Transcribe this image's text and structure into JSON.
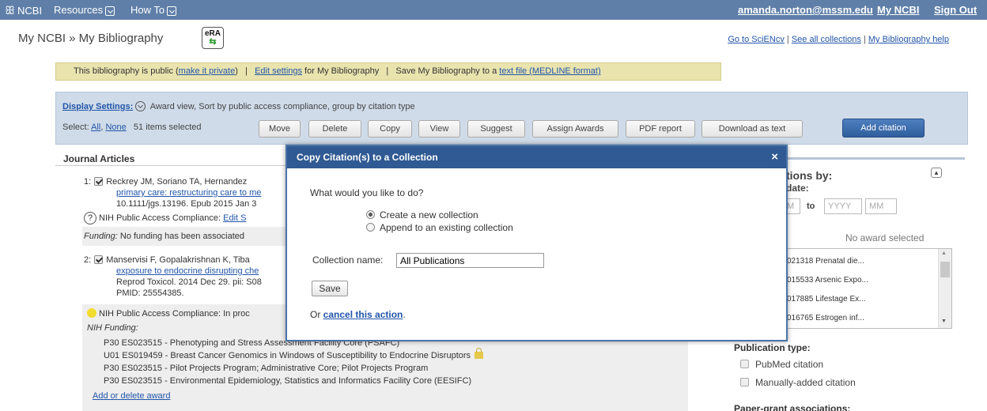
{
  "topbar": {
    "logo": "NCBI",
    "resources": "Resources",
    "howto": "How To",
    "user_email": "amanda.norton@mssm.edu",
    "my_ncbi": "My NCBI",
    "sign_out": "Sign Out"
  },
  "header": {
    "title": "My NCBI » My Bibliography",
    "era_top": "eRA",
    "era_arrow": "⇆",
    "links": [
      "Go to SciENcv",
      "See all collections",
      "My Bibliography help"
    ]
  },
  "notice": {
    "t1": "This bibliography is public (",
    "make_private": "make it private",
    "t2": ")",
    "sep": "|",
    "edit_settings": "Edit settings",
    "t3": " for My Bibliography",
    "t4": "Save My Bibliography to a ",
    "text_file": "text file (MEDLINE format)"
  },
  "display": {
    "label": "Display Settings:",
    "summary": "Award view, Sort by public access compliance, group by citation type",
    "select_label": "Select:",
    "all": "All",
    "none": "None",
    "count": "51 items selected"
  },
  "buttons": [
    "Move",
    "Delete",
    "Copy",
    "View",
    "Suggest",
    "Assign Awards",
    "PDF report",
    "Download as text"
  ],
  "add_citation": "Add citation",
  "journal": {
    "heading": "Journal Articles",
    "c1": {
      "num": "1:",
      "line1": "Reckrey JM, Soriano TA, Hernandez",
      "line2": "primary care: restructuring care to me",
      "line3": "10.1111/jgs.13196. Epub 2015 Jan 3",
      "compliance_icon": "?",
      "compliance": "NIH Public Access Compliance: ",
      "compliance_link": "Edit S",
      "funding_label": "Funding:",
      "funding": " No funding has been associated"
    },
    "c2": {
      "num": "2:",
      "line1": "Manservisi F, Gopalakrishnan K, Tiba",
      "line2": "exposure to endocrine disrupting che",
      "line3": "Reprod Toxicol. 2014 Dec 29. pii: S08",
      "line4": "PMID: 25554385.",
      "compliance": "NIH Public Access Compliance: In proc",
      "funding_label": "NIH Funding:",
      "awards": [
        "P30 ES023515 - Phenotyping and Stress Assessment Facility Core (PSAFC)",
        "U01 ES019459 - Breast Cancer Genomics in Windows of Susceptibility to Endocrine Disruptors",
        "P30 ES023515 - Pilot Projects Program; Administrative Core; Pilot Projects Program",
        "P30 ES023515 - Environmental Epidemiology, Statistics and Informatics Facility Core (EESIFC)"
      ],
      "add_award": "Add or delete award"
    }
  },
  "sidebar": {
    "heading": "tions by:",
    "date_label": "date:",
    "date_to": "to",
    "yyyy": "YYYY",
    "mm1": "M",
    "mm2": "MM",
    "no_award": "No award selected",
    "awards": [
      "021318 Prenatal die...",
      "015533 Arsenic Expo...",
      "017885 Lifestage Ex...",
      "016765 Estrogen inf..."
    ],
    "pubtype_label": "Publication type:",
    "pubtypes": [
      "PubMed citation",
      "Manually-added citation"
    ],
    "paper_grant": "Paper-grant associations:"
  },
  "modal": {
    "title": "Copy Citation(s) to a Collection",
    "close": "×",
    "question": "What would you like to do?",
    "opt1": "Create a new collection",
    "opt2": "Append to an existing collection",
    "name_label": "Collection name:",
    "name_value": "All Publications",
    "save": "Save",
    "or": "Or ",
    "cancel": "cancel this action",
    "period": "."
  }
}
